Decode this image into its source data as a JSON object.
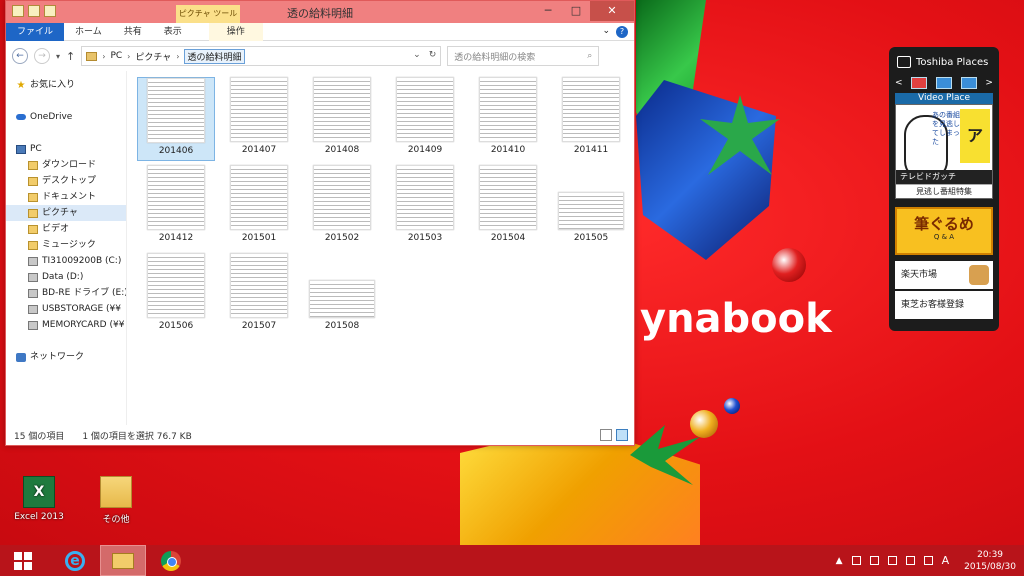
{
  "window": {
    "title": "透の給料明細",
    "context_tab": "ピクチャ ツール",
    "ribbon_tabs": [
      "ファイル",
      "ホーム",
      "共有",
      "表示",
      "操作"
    ],
    "minimize": "─",
    "maximize": "□",
    "close": "✕",
    "help": "?",
    "expand": "⌄"
  },
  "nav": {
    "back": "←",
    "forward": "→",
    "recent": "▾",
    "up": "↑",
    "breadcrumb": [
      "PC",
      "ピクチャ",
      "透の給料明細"
    ],
    "sep": "›",
    "dropdown": "⌄",
    "refresh": "↻",
    "search_placeholder": "透の給料明細の検索",
    "search_icon": "⌕"
  },
  "sidebar": {
    "favorites": "お気に入り",
    "onedrive": "OneDrive",
    "pc": "PC",
    "items": [
      "ダウンロード",
      "デスクトップ",
      "ドキュメント",
      "ピクチャ",
      "ビデオ",
      "ミュージック",
      "TI31009200B (C:)",
      "Data (D:)",
      "BD-RE ドライブ (E:)",
      "USBSTORAGE (¥¥",
      "MEMORYCARD (¥¥"
    ],
    "network": "ネットワーク"
  },
  "files": [
    "201406",
    "201407",
    "201408",
    "201409",
    "201410",
    "201411",
    "201412",
    "201501",
    "201502",
    "201503",
    "201504",
    "201505",
    "201506",
    "201507",
    "201508"
  ],
  "status": {
    "count": "15 個の項目",
    "selection": "1 個の項目を選択  76.7 KB"
  },
  "brand": "ynabook",
  "toshiba_places": {
    "title": "Toshiba Places",
    "prev": "<",
    "next": ">",
    "video_place": "Video Place",
    "banner_bar": "テレビドガッチ",
    "banner_caption": "見逃し番組特集",
    "banner_yel": "ア",
    "banner_text": "あの番組を見逃してしまった",
    "fude_title": "筆ぐるめ",
    "fude_sub": "Q & A",
    "rakuten": "楽天市場",
    "toshiba_reg": "東芝お客様登録"
  },
  "desktop_icons": [
    {
      "label": "Excel 2013",
      "glyph": "X"
    },
    {
      "label": "その他"
    }
  ],
  "tray": {
    "up": "▲",
    "ime": "A",
    "time": "20:39",
    "date": "2015/08/30"
  }
}
